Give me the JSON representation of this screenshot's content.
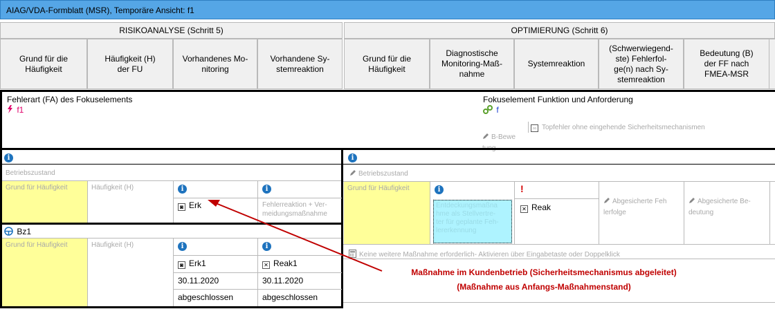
{
  "window": {
    "title": "AIAG/VDA-Formblatt (MSR), Temporäre Ansicht: f1"
  },
  "sections": {
    "risk": "RISIKOANALYSE (Schritt 5)",
    "opt": "OPTIMIERUNG (Schritt 6)"
  },
  "columns": [
    "Grund für die Häufigkeit",
    "Häufigkeit (H) der FU",
    "Vorhandenes Monitoring",
    "Vorhandene Systemreaktion",
    "Grund für die Häufigkeit",
    "Diagnostische Monitoring-Maßnahme",
    "Systemreaktion",
    "(Schwerwiegendste) Fehlerfolge(n) nach Systemreaktion",
    "Bedeutung (B) der FF nach FMEA-MSR"
  ],
  "column_display": [
    "Grund für die\nHäufigkeit",
    "Häufigkeit (H)\nder FU",
    "Vorhandenes Mo-\nnitoring",
    "Vorhandene Sy-\nstemreaktion",
    "Grund für die\nHäufigkeit",
    "Diagnostische\nMonitoring-Maß-\nnahme",
    "Systemreaktion",
    "(Schwerwiegend-\nste) Fehlerfol-\nge(n) nach Sy-\nstemreaktion",
    "Bedeutung (B)\nder FF nach\nFMEA-MSR"
  ],
  "focus": {
    "fa_label": "Fehlerart (FA) des Fokuselements",
    "fa_value": "f1",
    "func_label": "Fokuselement Funktion und Anforderung",
    "func_value": "f",
    "b_label": "B-Bewertung",
    "b_display": "B-Bewe\ntung",
    "top_label": "Topfehler ohne eingehende Sicherheitsmechanismen"
  },
  "left": {
    "operating_state": "Betriebszustand",
    "reason_placeholder": "Grund für Häufigkeit",
    "freq_placeholder": "Häufigkeit (H)",
    "monitoring_value": "Erk",
    "reaction_placeholder": "Fehlerreaktion + Vermeidungsmaßnahme",
    "reaction_display": "Fehlerreaktion + Ver-\nmeidungsmaßnahme",
    "bz_label": "Bz1",
    "reason2_placeholder": "Grund für Häufigkeit",
    "freq2_placeholder": "Häufigkeit (H)",
    "monitoring2_value": "Erk1",
    "reaction2_value": "Reak1",
    "date1": "30.11.2020",
    "date2": "30.11.2020",
    "status1": "abgeschlossen",
    "status2": "abgeschlossen"
  },
  "right": {
    "operating_state": "Betriebszustand",
    "reason_placeholder": "Grund für Häufigkeit",
    "detection_placeholder": "Entdeckungsmaßnahme als Stellvertreter für geplante Fehlererkennung",
    "detection_display": "Entdeckungsmaßna\nhme als Stellvertre-\nter für geplante Feh-\nlererkennung",
    "reaction_value": "Reak",
    "secured_effect": "Abgesicherte Fehlerfolge",
    "secured_effect_display": "Abgesicherte Feh\nlerfolge",
    "secured_severity": "Abgesicherte Bedeutung",
    "secured_severity_display": "Abgesicherte Be-\ndeutung",
    "no_further": "Keine weitere Maßnahme erforderlich- Aktivieren über Eingabetaste oder Doppelklick"
  },
  "annotation": {
    "line1": "Maßnahme im Kundenbetrieb (Sicherheitsmechanismus abgeleitet)",
    "line2": "(Maßnahme aus Anfangs-Maßnahmenstand)"
  },
  "colors": {
    "title": "#55a6e6",
    "yellow": "#ffff99",
    "cyan": "#aef3ff",
    "info": "#1e73be",
    "arrow": "#c00000",
    "focus_red": "#e0006a",
    "focus_blue": "#1a3fd0"
  }
}
